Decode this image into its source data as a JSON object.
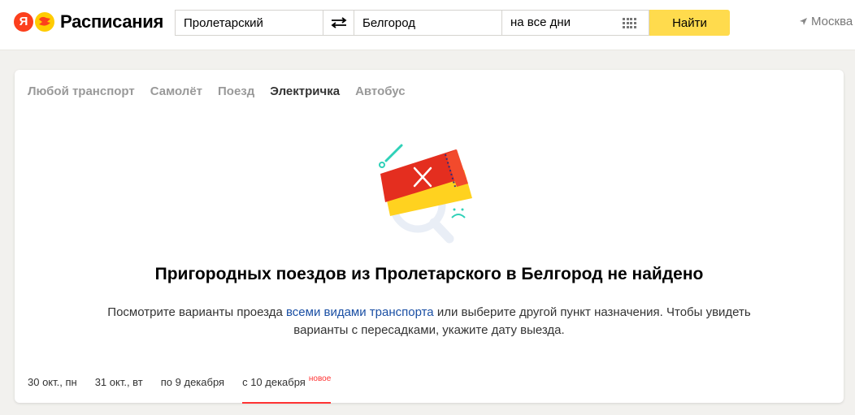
{
  "header": {
    "logo_letter": "Я",
    "brand": "Расписания",
    "from_value": "Пролетарский",
    "to_value": "Белгород",
    "date_value": "на все дни",
    "find_label": "Найти",
    "city": "Москва"
  },
  "tabs": [
    {
      "label": "Любой транспорт"
    },
    {
      "label": "Самолёт"
    },
    {
      "label": "Поезд"
    },
    {
      "label": "Электричка"
    },
    {
      "label": "Автобус"
    }
  ],
  "empty": {
    "title": "Пригородных поездов из Пролетарского в Белгород не найдено",
    "desc_before": "Посмотрите варианты проезда ",
    "desc_link": "всеми видами транспорта",
    "desc_after": " или выберите другой пункт назначения. Чтобы увидеть варианты с пересадками, укажите дату выезда."
  },
  "dates": [
    {
      "label": "30 окт., пн"
    },
    {
      "label": "31 окт., вт"
    },
    {
      "label": "по 9 декабря"
    },
    {
      "label": "с 10 декабря",
      "badge": "новое"
    }
  ],
  "colors": {
    "accent_yellow": "#ffdb4d",
    "brand_red": "#fc3f1d",
    "link_blue": "#1a4fa4",
    "badge_red": "#ff3333"
  }
}
